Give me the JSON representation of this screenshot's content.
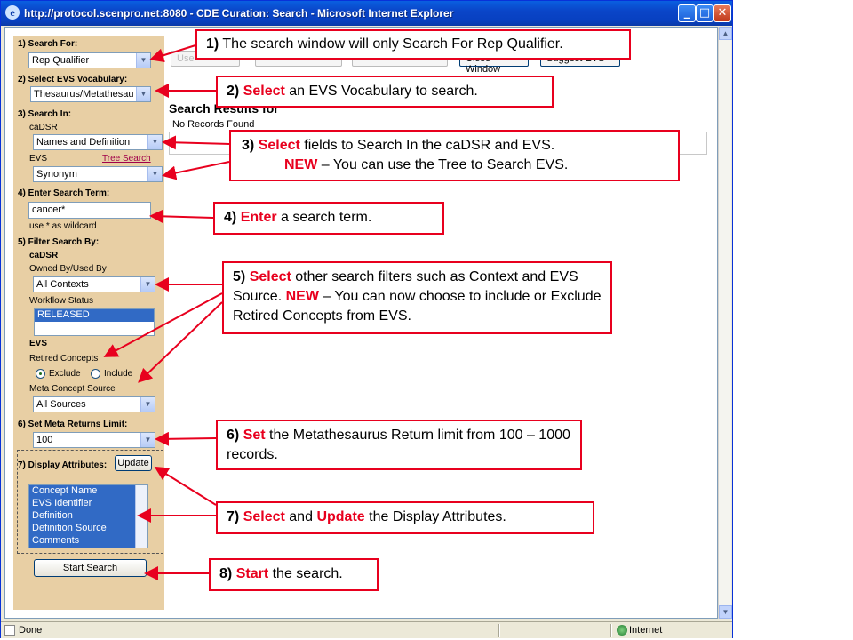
{
  "window": {
    "title": "http://protocol.scenpro.net:8080 - CDE Curation: Search - Microsoft Internet Explorer",
    "minimize": "_",
    "maximize": "□",
    "close": "✕"
  },
  "status": {
    "left": "Done",
    "zone": "Internet"
  },
  "panel": {
    "search_for_label": "1) Search For:",
    "search_for_value": "Rep Qualifier",
    "vocab_label": "2) Select EVS Vocabulary:",
    "vocab_value": "Thesaurus/Metathesau",
    "search_in_label": "3) Search In:",
    "cadsr_label": "caDSR",
    "cadsr_value": "Names and Definition",
    "evs_label": "EVS",
    "tree_search": "Tree Search",
    "evs_value": "Synonym",
    "term_label": "4) Enter Search Term:",
    "term_value": "cancer*",
    "wildcard_hint": "use * as wildcard",
    "filter_label": "5) Filter Search By:",
    "filter_cadsr": "caDSR",
    "owned_label": "Owned By/Used By",
    "owned_value": "All Contexts",
    "workflow_label": "Workflow Status",
    "workflow_items": [
      "RELEASED"
    ],
    "evs2_label": "EVS",
    "retired_label": "Retired Concepts",
    "exclude_label": "Exclude",
    "include_label": "Include",
    "meta_source_label": "Meta Concept Source",
    "meta_source_value": "All Sources",
    "limit_label": "6) Set Meta Returns Limit:",
    "limit_value": "100",
    "display_label": "7) Display Attributes:",
    "update_button": "Update",
    "display_items": [
      "Concept Name",
      "EVS Identifier",
      "Definition",
      "Definition Source",
      "Comments"
    ],
    "start_button": "Start Search"
  },
  "main": {
    "buttons": [
      "Use",
      "Close Window",
      "Suggest EVS"
    ],
    "results_title": "Search Results for",
    "no_records": "No Records Found"
  },
  "callouts": {
    "c1": {
      "num": "1)",
      "text": "The search window will only Search For Rep Qualifier."
    },
    "c2": {
      "num": "2)",
      "verb": "Select",
      "text": "an EVS Vocabulary to search."
    },
    "c3": {
      "num": "3)",
      "verb": "Select",
      "text": "fields to Search In the caDSR and EVS.",
      "new": "NEW",
      "text2": "– You can use the Tree to Search EVS."
    },
    "c4": {
      "num": "4)",
      "verb": "Enter",
      "text": "a search term."
    },
    "c5": {
      "num": "5)",
      "verb": "Select",
      "text": "other search filters such as Context and EVS Source.",
      "new": "NEW",
      "text2": "– You can now choose to include or Exclude Retired Concepts from EVS."
    },
    "c6": {
      "num": "6)",
      "verb": "Set",
      "text": "the Metathesaurus Return limit from 100 – 1000 records."
    },
    "c7": {
      "num": "7)",
      "verb": "Select",
      "and": "and",
      "verb2": "Update",
      "text": "the Display Attributes."
    },
    "c8": {
      "num": "8)",
      "verb": "Start",
      "text": "the search."
    }
  }
}
